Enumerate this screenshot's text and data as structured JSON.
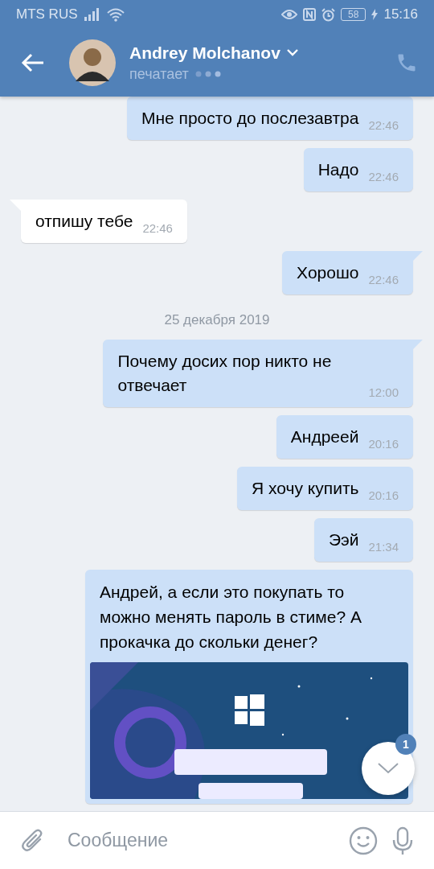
{
  "status_bar": {
    "carrier": "MTS RUS",
    "battery": "58",
    "time": "15:16"
  },
  "header": {
    "name": "Andrey Molchanov",
    "status": "печатает"
  },
  "messages": [
    {
      "kind": "text",
      "outgoing": true,
      "text": "Мне просто до послезавтра",
      "time": "22:46",
      "tail": false
    },
    {
      "kind": "text",
      "outgoing": true,
      "text": "Надо",
      "time": "22:46",
      "tail": false
    },
    {
      "kind": "text",
      "outgoing": false,
      "text": "отпишу тебе",
      "time": "22:46",
      "tail": true
    },
    {
      "kind": "text",
      "outgoing": true,
      "text": "Хорошо",
      "time": "22:46",
      "tail": true
    },
    {
      "kind": "date",
      "text": "25 декабря 2019"
    },
    {
      "kind": "text",
      "outgoing": true,
      "text": "Почему досих пор никто не отвечает",
      "time": "12:00",
      "tail": true
    },
    {
      "kind": "text",
      "outgoing": true,
      "text": "Андреей",
      "time": "20:16",
      "tail": false
    },
    {
      "kind": "text",
      "outgoing": true,
      "text": "Я хочу купить",
      "time": "20:16",
      "tail": false
    },
    {
      "kind": "text",
      "outgoing": true,
      "text": "Ээй",
      "time": "21:34",
      "tail": false
    },
    {
      "kind": "picture",
      "outgoing": true,
      "text": "Андрей, а если это покупать то можно менять пароль в стиме? А прокачка до скольки денег?",
      "tail": false
    }
  ],
  "scroll_button": {
    "badge": "1"
  },
  "composer": {
    "placeholder": "Сообщение"
  }
}
